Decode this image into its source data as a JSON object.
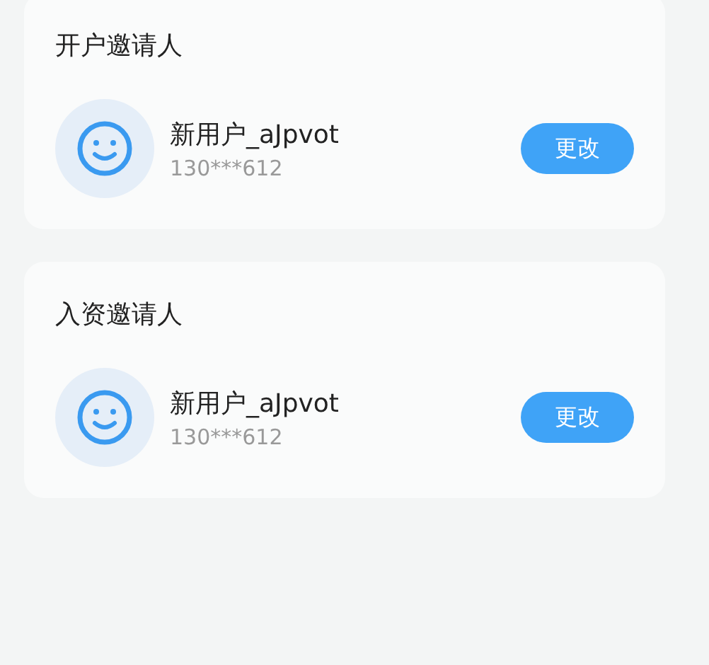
{
  "sections": [
    {
      "title": "开户邀请人",
      "user": {
        "name": "新用户_aJpvot",
        "phone": "130***612"
      },
      "button": "更改"
    },
    {
      "title": "入资邀请人",
      "user": {
        "name": "新用户_aJpvot",
        "phone": "130***612"
      },
      "button": "更改"
    }
  ]
}
